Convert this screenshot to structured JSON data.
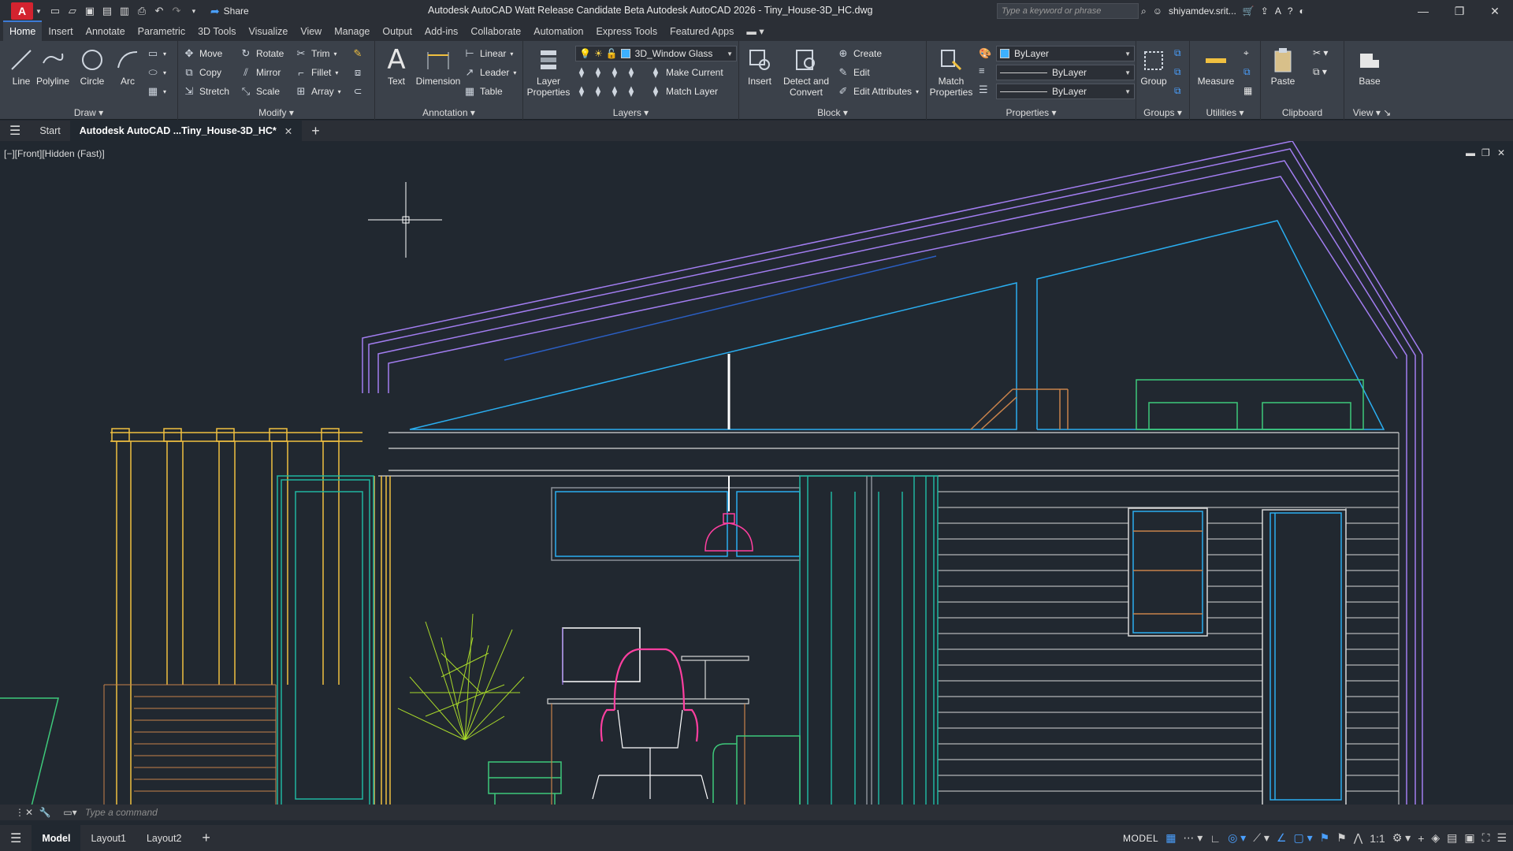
{
  "app": {
    "title": "Autodesk AutoCAD Watt Release Candidate Beta   Autodesk AutoCAD 2026 - Tiny_House-3D_HC.dwg",
    "logo": "A",
    "share_label": "Share",
    "search_placeholder": "Type a keyword or phrase",
    "user": "shiyamdev.srit...",
    "help": "?"
  },
  "ribbon_tabs": [
    "Home",
    "Insert",
    "Annotate",
    "Parametric",
    "3D Tools",
    "Visualize",
    "View",
    "Manage",
    "Output",
    "Add-ins",
    "Collaborate",
    "Automation",
    "Express Tools",
    "Featured Apps"
  ],
  "draw": {
    "title": "Draw",
    "line": "Line",
    "polyline": "Polyline",
    "circle": "Circle",
    "arc": "Arc"
  },
  "modify": {
    "title": "Modify",
    "move": "Move",
    "rotate": "Rotate",
    "trim": "Trim",
    "copy": "Copy",
    "mirror": "Mirror",
    "fillet": "Fillet",
    "stretch": "Stretch",
    "scale": "Scale",
    "array": "Array"
  },
  "annotation": {
    "title": "Annotation",
    "text": "Text",
    "dimension": "Dimension",
    "linear": "Linear",
    "leader": "Leader",
    "table": "Table"
  },
  "layers": {
    "title": "Layers",
    "layer_properties": "Layer Properties",
    "current_layer": "3D_Window Glass",
    "make_current": "Make Current",
    "match_layer": "Match Layer"
  },
  "block": {
    "title": "Block",
    "insert": "Insert",
    "detect_convert": "Detect and Convert",
    "create": "Create",
    "edit": "Edit",
    "edit_attributes": "Edit Attributes"
  },
  "properties": {
    "title": "Properties",
    "match_properties": "Match Properties",
    "color": "ByLayer",
    "linetype": "ByLayer",
    "lineweight": "ByLayer"
  },
  "groups": {
    "title": "Groups",
    "group": "Group"
  },
  "utilities": {
    "title": "Utilities",
    "measure": "Measure"
  },
  "clipboard": {
    "title": "Clipboard",
    "paste": "Paste"
  },
  "view_panel": {
    "title": "View",
    "base": "Base"
  },
  "doc_tabs": {
    "start": "Start",
    "active": "Autodesk AutoCAD ...Tiny_House-3D_HC*"
  },
  "viewport": {
    "label": "[−][Front][Hidden (Fast)]"
  },
  "command": {
    "placeholder": "Type a command"
  },
  "status": {
    "tabs": [
      "Model",
      "Layout1",
      "Layout2"
    ],
    "model_badge": "MODEL",
    "scale": "1:1"
  },
  "colors": {
    "accent": "#3d7bd6",
    "background": "#212830",
    "ribbon": "#3b414a"
  }
}
